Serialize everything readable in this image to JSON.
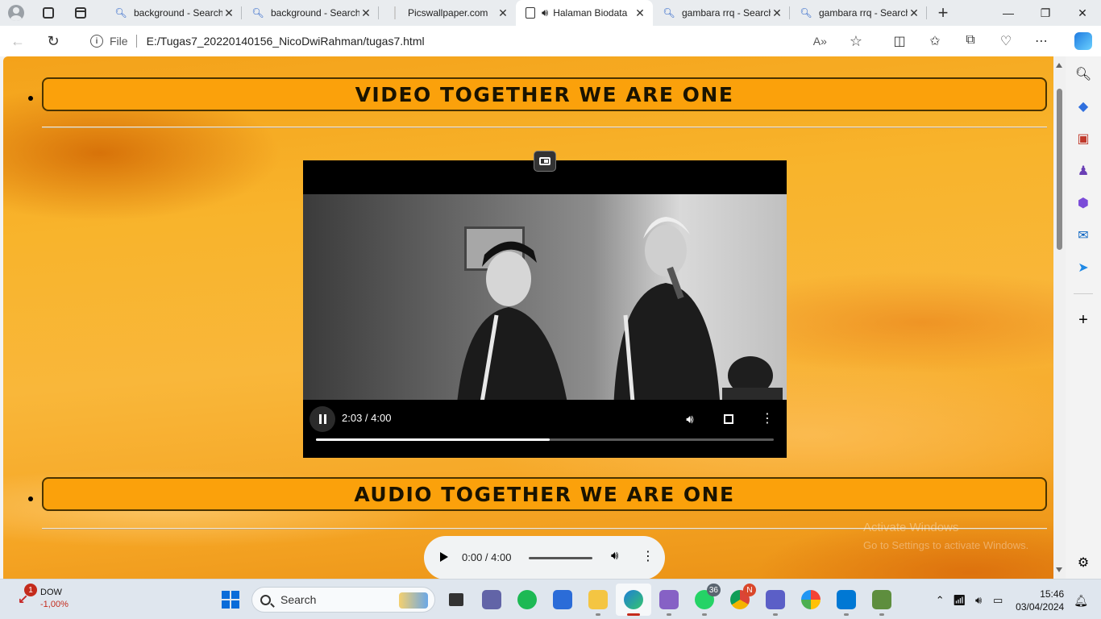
{
  "browser": {
    "tabs": [
      {
        "title": "background - Search",
        "icon": "search-icon",
        "active": false
      },
      {
        "title": "background - Search",
        "icon": "search-icon",
        "active": false
      },
      {
        "title": "Picswallpaper.com",
        "icon": "blank-page-icon",
        "active": false
      },
      {
        "title": "Halaman Biodata",
        "icon": "document-icon",
        "active": true,
        "audio": true
      },
      {
        "title": "gambara rrq - Search",
        "icon": "search-icon",
        "active": false
      },
      {
        "title": "gambara rrq - Search",
        "icon": "search-icon",
        "active": false
      }
    ],
    "address": {
      "scheme_label": "File",
      "url": "E:/Tugas7_20220140156_NicoDwiRahman/tugas7.html"
    }
  },
  "page": {
    "video_heading": "VIDEO TOGETHER WE ARE ONE",
    "audio_heading": "AUDIO TOGETHER WE ARE ONE",
    "video": {
      "time_display": "2:03 / 4:00",
      "current": "2:03",
      "duration": "4:00",
      "progress": 0.51,
      "state": "playing"
    },
    "audio": {
      "time_display": "0:00 / 4:00",
      "current": "0:00",
      "duration": "4:00",
      "progress": 0,
      "state": "paused"
    },
    "watermark": {
      "title": "Activate Windows",
      "subtitle": "Go to Settings to activate Windows."
    }
  },
  "taskbar": {
    "stock": {
      "name": "DOW",
      "change": "-1,00%",
      "badge": "1"
    },
    "search_placeholder": "Search",
    "badges": {
      "whatsapp": "36",
      "chrome": "N"
    },
    "clock": {
      "time": "15:46",
      "date": "03/04/2024"
    }
  },
  "colors": {
    "heading_fill": "#fba10b",
    "heading_border": "#4a3300",
    "page_background": "#f8b42c",
    "edge_accent": "#0a6cd9"
  }
}
